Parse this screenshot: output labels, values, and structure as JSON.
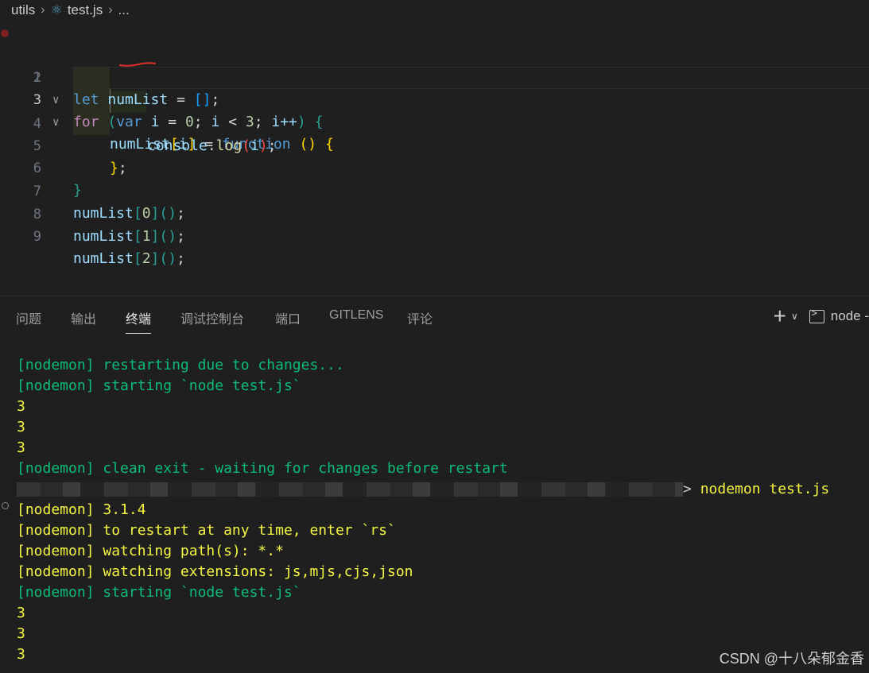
{
  "breadcrumb": {
    "folder": "utils",
    "file": "test.js",
    "more": "..."
  },
  "editor": {
    "line_numbers": [
      "1",
      "2",
      "3",
      "4",
      "5",
      "6",
      "7",
      "8",
      "9"
    ],
    "lines": {
      "l1": {
        "kw": "let",
        "name": "numList",
        "eq": "=",
        "arr": "[]",
        "semi": ";"
      },
      "l2": {
        "kw": "for",
        "open": "(",
        "var": "var",
        "i": "i",
        "eq": "=",
        "zero": "0",
        "semi": ";",
        "i2": "i",
        "lt": "<",
        "three": "3",
        "semi2": ";",
        "inc": "i++",
        "close": ")",
        "brace": "{"
      },
      "l3": {
        "name": "numList",
        "lb": "[",
        "i": "i",
        "rb": "]",
        "eq": "=",
        "fn": "function",
        "parens": "()",
        "brace": "{"
      },
      "l4": {
        "obj": "console",
        "dot": ".",
        "method": "log",
        "open": "(",
        "arg": "i",
        "close": ")",
        "semi": ";"
      },
      "l5": {
        "close": "}",
        "semi": ";"
      },
      "l6": {
        "close": "}"
      },
      "l7": {
        "name": "numList",
        "lb": "[",
        "idx": "0",
        "rb": "]",
        "call": "()",
        "semi": ";"
      },
      "l8": {
        "name": "numList",
        "lb": "[",
        "idx": "1",
        "rb": "]",
        "call": "()",
        "semi": ";"
      },
      "l9": {
        "name": "numList",
        "lb": "[",
        "idx": "2",
        "rb": "]",
        "call": "()",
        "semi": ";"
      }
    }
  },
  "panel": {
    "tabs": [
      "问题",
      "输出",
      "终端",
      "调试控制台",
      "端口",
      "GITLENS",
      "评论"
    ],
    "active_tab": "终端",
    "add": "+",
    "terminal_name": "node -"
  },
  "terminal": {
    "lines": [
      "[nodemon] restarting due to changes...",
      "[nodemon] starting `node test.js`",
      "3",
      "3",
      "3",
      "[nodemon] clean exit - waiting for changes before restart",
      "> nodemon test.js",
      "[nodemon] 3.1.4",
      "[nodemon] to restart at any time, enter `rs`",
      "[nodemon] watching path(s): *.*",
      "[nodemon] watching extensions: js,mjs,cjs,json",
      "[nodemon] starting `node test.js`",
      "3",
      "3",
      "3"
    ],
    "prompt_cmd": "nodemon test.js",
    "prompt_arrow": ">"
  },
  "watermark": "CSDN @十八朵郁金香",
  "colors": {
    "background": "#1f1f1f",
    "nodemon_green": "#23d18b",
    "nodemon_yellow": "#f5f543",
    "keyword_blue": "#569cd6",
    "control_purple": "#c586c0",
    "variable_lightblue": "#9cdcfe",
    "function_yellow": "#dcdcaa"
  }
}
